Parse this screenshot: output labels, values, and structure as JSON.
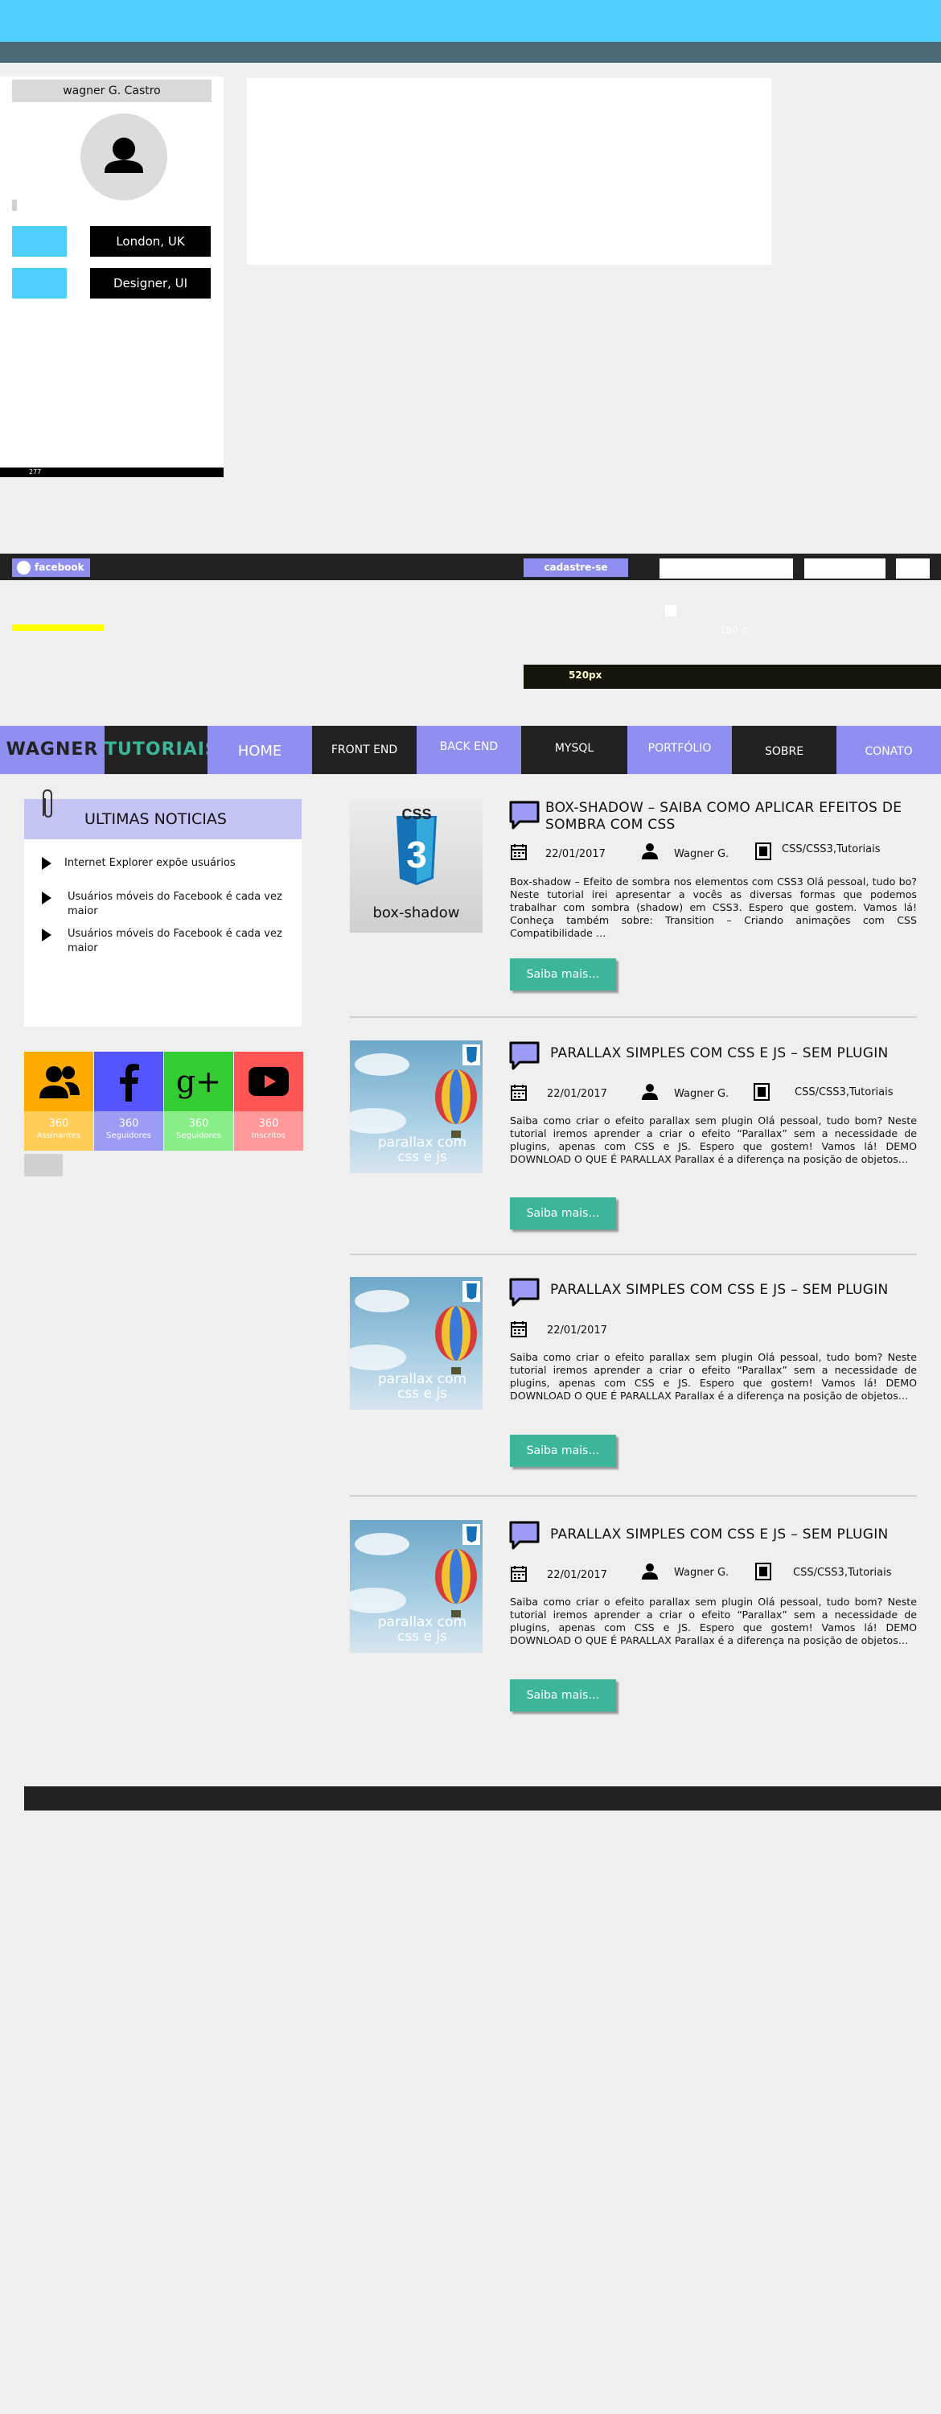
{
  "profile": {
    "name": "wagner G. Castro",
    "location": "London, UK",
    "role": "Designer, UI",
    "footer_number": "277"
  },
  "topbar": {
    "facebook_label": "facebook",
    "signup_label": "cadastre-se"
  },
  "ghost_text": "180 ρ",
  "dark_box_label": "520px",
  "nav": {
    "logo_left": "WAGNER",
    "logo_right": "TUTORIAIS",
    "items": [
      "HOME",
      "FRONT END",
      "BACK END",
      "MYSQL",
      "PORTFÓLIO",
      "SOBRE",
      "CONATO"
    ]
  },
  "news": {
    "title": "ULTIMAS NOTICIAS",
    "items": [
      "Internet Explorer expõe usuários",
      "Usuários móveis do Facebook é cada vez maior",
      "Usuários móveis do Facebook é cada vez maior"
    ]
  },
  "social": [
    {
      "count": "360",
      "label": "Assinantes",
      "color_top": "#ffaa00",
      "color_bottom": "#ffcc55",
      "icon": "users-icon"
    },
    {
      "count": "360",
      "label": "Seguidores",
      "color_top": "#5555ff",
      "color_bottom": "#9c9cf5",
      "icon": "facebook-icon"
    },
    {
      "count": "360",
      "label": "Seguidores",
      "color_top": "#33cc33",
      "color_bottom": "#88ee88",
      "icon": "google-plus-icon"
    },
    {
      "count": "360",
      "label": "Inscritos",
      "color_top": "#ff5555",
      "color_bottom": "#ff9999",
      "icon": "youtube-icon"
    }
  ],
  "posts": [
    {
      "title": "BOX-SHADOW – SAIBA COMO APLICAR EFEITOS DE SOMBRA COM CSS",
      "date": "22/01/2017",
      "author": "Wagner G.",
      "category": "CSS/CSS3,Tutoriais",
      "body": "Box-shadow – Efeito de sombra nos elementos com CSS3 Olá pessoal, tudo bo? Neste tutorial irei apresentar a vocês as diversas formas que podemos trabalhar com sombra (shadow) em CSS3. Espero que gostem. Vamos lá! Conheça também sobre: Transition – Criando animações com CSS Compatibilidade …",
      "button": "Saiba mais…",
      "thumb_text": "box-shadow",
      "thumb_badge": "CSS"
    },
    {
      "title": "PARALLAX SIMPLES COM CSS E JS – SEM PLUGIN",
      "date": "22/01/2017",
      "author": "Wagner G.",
      "category": "CSS/CSS3,Tutoriais",
      "body": "Saiba como criar o efeito parallax sem plugin Olá pessoal, tudo bom? Neste tutorial iremos aprender a criar o efeito “Parallax” sem a necessidade de plugins, apenas com CSS e JS. Espero que gostem! Vamos lá! DEMO DOWNLOAD O QUE É PARALLAX Parallax é a diferença na posição de objetos…",
      "button": "Saiba mais…",
      "thumb_text": "parallax com css e js"
    },
    {
      "title": "PARALLAX SIMPLES COM CSS E JS – SEM PLUGIN",
      "date": "22/01/2017",
      "body": "Saiba como criar o efeito parallax sem plugin Olá pessoal, tudo bom? Neste tutorial iremos aprender a criar o efeito “Parallax” sem a necessidade de plugins, apenas com CSS e JS. Espero que gostem! Vamos lá! DEMO DOWNLOAD O QUE É PARALLAX Parallax é a diferença na posição de objetos…",
      "button": "Saiba mais…",
      "thumb_text": "parallax com css e js"
    },
    {
      "title": "PARALLAX SIMPLES COM CSS E JS – SEM PLUGIN",
      "date": "22/01/2017",
      "author": "Wagner G.",
      "category": "CSS/CSS3,Tutoriais",
      "body": "Saiba como criar o efeito parallax sem plugin Olá pessoal, tudo bom? Neste tutorial iremos aprender a criar o efeito “Parallax” sem a necessidade de plugins, apenas com CSS e JS. Espero que gostem! Vamos lá! DEMO DOWNLOAD O QUE É PARALLAX Parallax é a diferença na posição de objetos…",
      "button": "Saiba mais…",
      "thumb_text": "parallax com css e js"
    }
  ]
}
